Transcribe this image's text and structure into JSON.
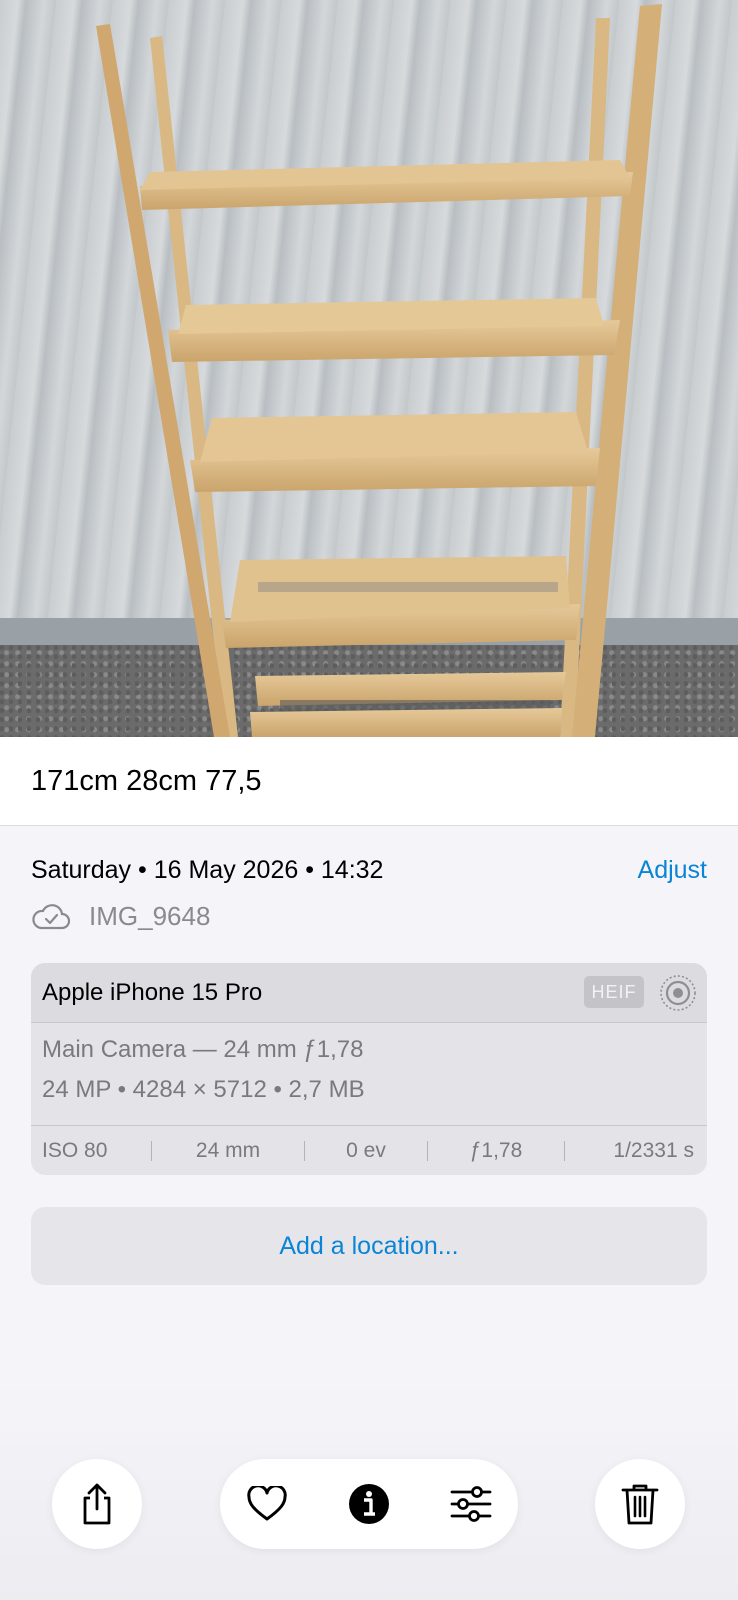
{
  "photo": {
    "icon": "photo-shelf-image"
  },
  "caption": {
    "text": "171cm 28cm 77,5"
  },
  "info": {
    "date_time": "Saturday • 16 May 2026 • 14:32",
    "adjust_label": "Adjust",
    "file_name": "IMG_9648",
    "cloud_icon": "cloud-check-icon"
  },
  "camera_card": {
    "device": "Apple iPhone 15 Pro",
    "format_badge": "HEIF",
    "live_icon": "live-photo-icon",
    "lens": "Main Camera — 24 mm ƒ1,78",
    "details": "24 MP • 4284 × 5712 • 2,7 MB",
    "exif": [
      "ISO 80",
      "24 mm",
      "0 ev",
      "ƒ1,78",
      "1/2331 s"
    ]
  },
  "location": {
    "label": "Add a location..."
  },
  "toolbar": {
    "share_icon": "share-icon",
    "favorite_icon": "heart-icon",
    "info_icon": "info-icon",
    "edit_icon": "sliders-icon",
    "delete_icon": "trash-icon"
  },
  "colors": {
    "accent": "#0a84d6",
    "background": "#f5f5f9"
  }
}
